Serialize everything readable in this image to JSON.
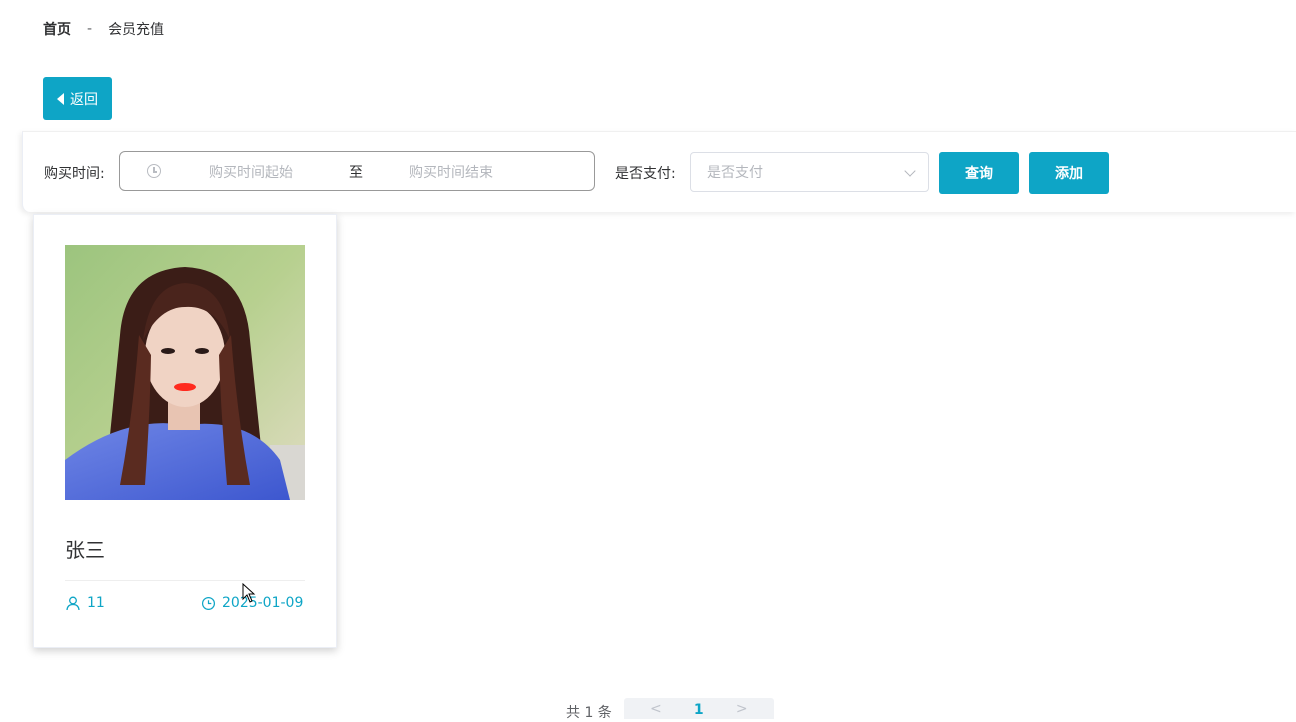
{
  "breadcrumb": {
    "home": "首页",
    "separator": "-",
    "current": "会员充值"
  },
  "back_button": {
    "label": "返回",
    "icon": "caret-left-icon"
  },
  "search": {
    "purchase_time_label": "购买时间:",
    "start_placeholder": "购买时间起始",
    "range_separator": "至",
    "end_placeholder": "购买时间结束",
    "paid_label": "是否支付:",
    "paid_placeholder": "是否支付",
    "query_button": "查询",
    "add_button": "添加"
  },
  "cards": [
    {
      "name": "张三",
      "user_count": "11",
      "date": "2025-01-09",
      "user_icon": "user-icon",
      "date_icon": "clock-icon"
    }
  ],
  "pagination": {
    "total_text": "共 1 条",
    "prev": "<",
    "current_page": "1",
    "next": ">"
  },
  "colors": {
    "accent": "#0ea5c6",
    "text": "#303133",
    "placeholder": "#b4b7bd"
  }
}
